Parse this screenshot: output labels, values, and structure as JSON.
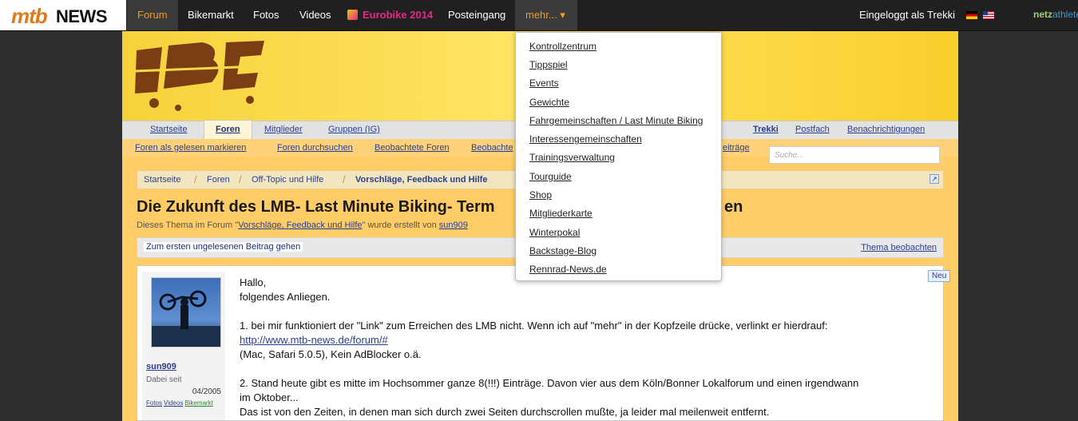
{
  "topbar": {
    "logo_mtb": "mtb",
    "logo_news": "NEWS",
    "nav": [
      "Forum",
      "Bikemarkt",
      "Fotos",
      "Videos",
      "Eurobike 2014",
      "Posteingang",
      "mehr... ▾"
    ],
    "logged_in": "Eingeloggt als Trekki",
    "partner_a": "netz",
    "partner_b": "athleten"
  },
  "header": {
    "tabs": [
      "Startseite",
      "Foren",
      "Mitglieder",
      "Gruppen (IG)"
    ],
    "right_links": [
      "Trekki",
      "Postfach",
      "Benachrichtigungen"
    ],
    "sub_links": [
      "Foren als gelesen markieren",
      "Foren durchsuchen",
      "Beobachtete Foren",
      "Beobachte",
      "eiträge"
    ],
    "search_placeholder": "Suche..."
  },
  "breadcrumb": [
    "Startseite",
    "Foren",
    "Off-Topic und Hilfe",
    "Vorschläge, Feedback und Hilfe"
  ],
  "thread": {
    "title": "Die Zukunft des LMB- Last Minute Biking- Term",
    "title_tail": "en",
    "meta_prefix": "Dieses Thema im Forum \"",
    "meta_forum": "Vorschläge, Feedback und Hilfe",
    "meta_mid": "\" wurde erstellt von ",
    "meta_user": "sun909",
    "first_unread": "Zum ersten ungelesenen Beitrag gehen",
    "watch": "Thema beobachten",
    "new_badge": "Neu"
  },
  "post": {
    "username": "sun909",
    "since_label": "Dabei seit",
    "since_value": "04/2005",
    "user_links": [
      "Fotos",
      "Videos",
      "Bikemarkt"
    ],
    "lines": [
      "Hallo,",
      "folgendes Anliegen.",
      "",
      "1. bei mir funktioniert der \"Link\" zum Erreichen des LMB nicht. Wenn ich auf \"mehr\" in der Kopfzeile drücke, verlinkt er hierdrauf:",
      "http://www.mtb-news.de/forum/#",
      "(Mac, Safari 5.0.5), Kein AdBlocker o.ä.",
      "",
      "2. Stand heute gibt es mitte im Hochsommer ganze 8(!!!) Einträge. Davon vier aus dem Köln/Bonner Lokalforum und einen irgendwann",
      "im Oktober...",
      "Das ist von den Zeiten, in denen man sich durch zwei Seiten durchscrollen mußte, ja leider mal meilenweit entfernt."
    ]
  },
  "dropdown": {
    "items": [
      "Kontrollzentrum",
      "Tippspiel",
      "Events",
      "Gewichte",
      "Fahrgemeinschaften / Last Minute Biking",
      "Interessengemeinschaften",
      "Trainingsverwaltung",
      "Tourguide",
      "Shop",
      "Mitgliederkarte",
      "Winterpokal",
      "Backstage-Blog",
      "Rennrad-News.de"
    ]
  },
  "colors": {
    "accent": "#f39c1f",
    "link": "#2a3f8f",
    "banner": "#ffd83a",
    "content": "#ffcc66"
  }
}
